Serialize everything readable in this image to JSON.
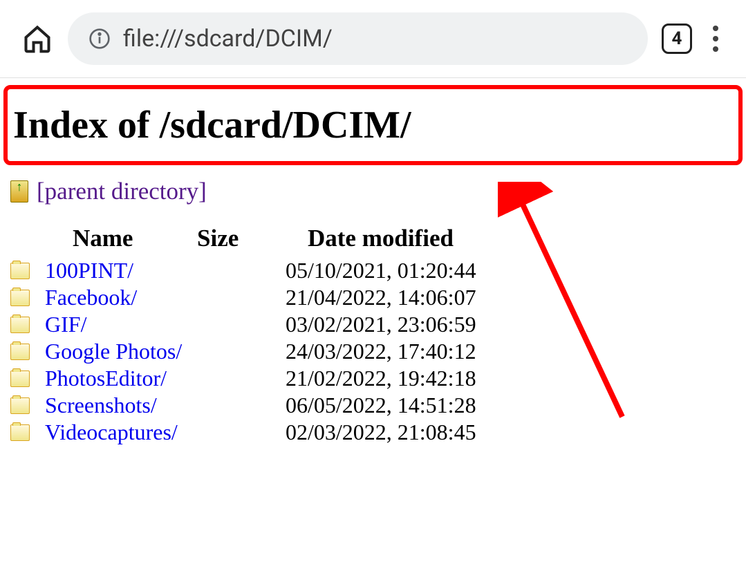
{
  "browser": {
    "url": "file:///sdcard/DCIM/",
    "tab_count": "4"
  },
  "page": {
    "heading": "Index of /sdcard/DCIM/",
    "parent_directory_label": "[parent directory]"
  },
  "table": {
    "headers": {
      "name": "Name",
      "size": "Size",
      "date": "Date modified"
    },
    "rows": [
      {
        "name": "100PINT/",
        "size": "",
        "date": "05/10/2021, 01:20:44"
      },
      {
        "name": "Facebook/",
        "size": "",
        "date": "21/04/2022, 14:06:07"
      },
      {
        "name": "GIF/",
        "size": "",
        "date": "03/02/2021, 23:06:59"
      },
      {
        "name": "Google Photos/",
        "size": "",
        "date": "24/03/2022, 17:40:12"
      },
      {
        "name": "PhotosEditor/",
        "size": "",
        "date": "21/02/2022, 19:42:18"
      },
      {
        "name": "Screenshots/",
        "size": "",
        "date": "06/05/2022, 14:51:28"
      },
      {
        "name": "Videocaptures/",
        "size": "",
        "date": "02/03/2022, 21:08:45"
      }
    ]
  }
}
